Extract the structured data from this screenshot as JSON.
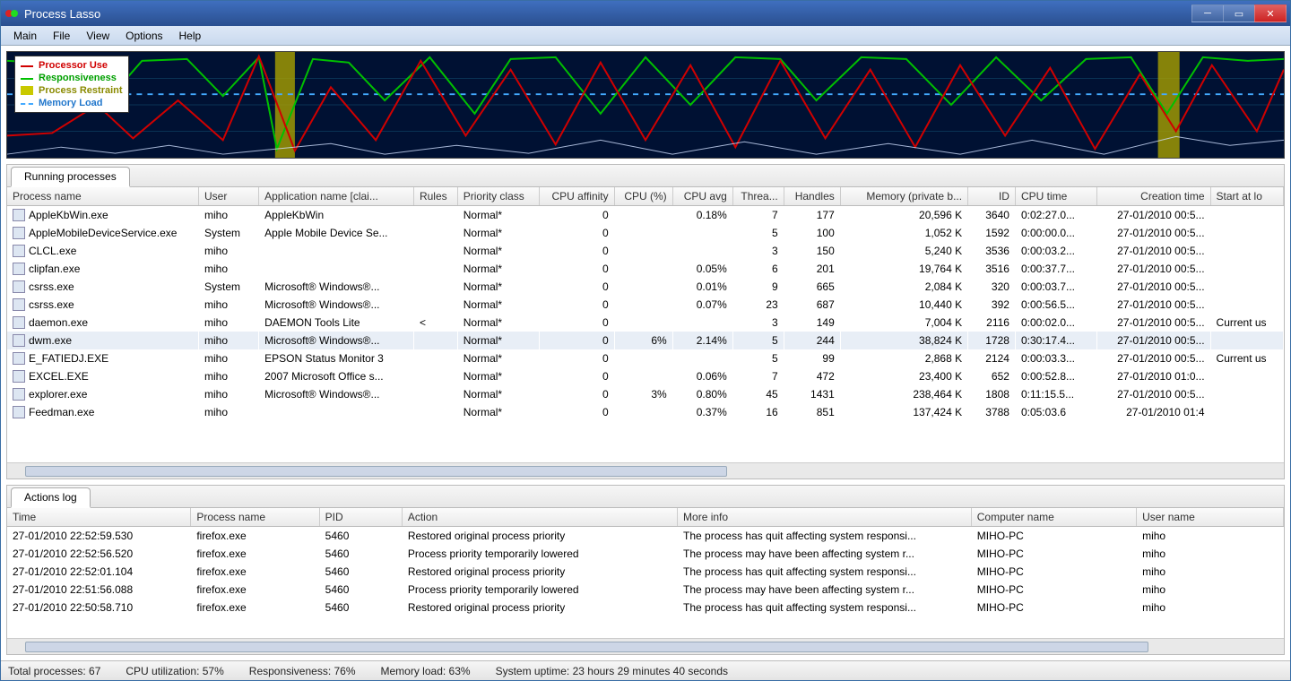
{
  "window": {
    "title": "Process Lasso"
  },
  "menu": [
    "Main",
    "File",
    "View",
    "Options",
    "Help"
  ],
  "legend": {
    "processor_use": "Processor Use",
    "responsiveness": "Responsiveness",
    "process_restraint": "Process Restraint",
    "memory_load": "Memory Load"
  },
  "colors": {
    "red": "#d00000",
    "green": "#00c000",
    "yellow": "#c9c900",
    "blue": "#44aaff",
    "graph_bg": "#001133"
  },
  "top_tab": "Running processes",
  "columns_top": [
    "Process name",
    "User",
    "Application name [clai...",
    "Rules",
    "Priority class",
    "CPU affinity",
    "CPU (%)",
    "CPU avg",
    "Threa...",
    "Handles",
    "Memory (private b...",
    "ID",
    "CPU time",
    "Creation time",
    "Start at lo"
  ],
  "processes": [
    {
      "name": "AppleKbWin.exe",
      "user": "miho",
      "app": "AppleKbWin",
      "rules": "",
      "prio": "Normal*",
      "aff": "0",
      "cpu": "",
      "avg": "0.18%",
      "thr": "7",
      "hnd": "177",
      "mem": "20,596 K",
      "id": "3640",
      "cputime": "0:02:27.0...",
      "ctime": "27-01/2010 00:5...",
      "start": ""
    },
    {
      "name": "AppleMobileDeviceService.exe",
      "user": "System",
      "app": "Apple Mobile Device Se...",
      "rules": "",
      "prio": "Normal*",
      "aff": "0",
      "cpu": "",
      "avg": "",
      "thr": "5",
      "hnd": "100",
      "mem": "1,052 K",
      "id": "1592",
      "cputime": "0:00:00.0...",
      "ctime": "27-01/2010 00:5...",
      "start": ""
    },
    {
      "name": "CLCL.exe",
      "user": "miho",
      "app": "",
      "rules": "",
      "prio": "Normal*",
      "aff": "0",
      "cpu": "",
      "avg": "",
      "thr": "3",
      "hnd": "150",
      "mem": "5,240 K",
      "id": "3536",
      "cputime": "0:00:03.2...",
      "ctime": "27-01/2010 00:5...",
      "start": ""
    },
    {
      "name": "clipfan.exe",
      "user": "miho",
      "app": "",
      "rules": "",
      "prio": "Normal*",
      "aff": "0",
      "cpu": "",
      "avg": "0.05%",
      "thr": "6",
      "hnd": "201",
      "mem": "19,764 K",
      "id": "3516",
      "cputime": "0:00:37.7...",
      "ctime": "27-01/2010 00:5...",
      "start": ""
    },
    {
      "name": "csrss.exe",
      "user": "System",
      "app": "Microsoft® Windows®...",
      "rules": "",
      "prio": "Normal*",
      "aff": "0",
      "cpu": "",
      "avg": "0.01%",
      "thr": "9",
      "hnd": "665",
      "mem": "2,084 K",
      "id": "320",
      "cputime": "0:00:03.7...",
      "ctime": "27-01/2010 00:5...",
      "start": ""
    },
    {
      "name": "csrss.exe",
      "user": "miho",
      "app": "Microsoft® Windows®...",
      "rules": "",
      "prio": "Normal*",
      "aff": "0",
      "cpu": "",
      "avg": "0.07%",
      "thr": "23",
      "hnd": "687",
      "mem": "10,440 K",
      "id": "392",
      "cputime": "0:00:56.5...",
      "ctime": "27-01/2010 00:5...",
      "start": ""
    },
    {
      "name": "daemon.exe",
      "user": "miho",
      "app": "DAEMON Tools Lite",
      "rules": "<",
      "prio": "Normal*",
      "aff": "0",
      "cpu": "",
      "avg": "",
      "thr": "3",
      "hnd": "149",
      "mem": "7,004 K",
      "id": "2116",
      "cputime": "0:00:02.0...",
      "ctime": "27-01/2010 00:5...",
      "start": "Current us"
    },
    {
      "name": "dwm.exe",
      "user": "miho",
      "app": "Microsoft® Windows®...",
      "rules": "",
      "prio": "Normal*",
      "aff": "0",
      "cpu": "6%",
      "avg": "2.14%",
      "thr": "5",
      "hnd": "244",
      "mem": "38,824 K",
      "id": "1728",
      "cputime": "0:30:17.4...",
      "ctime": "27-01/2010 00:5...",
      "start": "",
      "_selected": true
    },
    {
      "name": "E_FATIEDJ.EXE",
      "user": "miho",
      "app": "EPSON Status Monitor 3",
      "rules": "",
      "prio": "Normal*",
      "aff": "0",
      "cpu": "",
      "avg": "",
      "thr": "5",
      "hnd": "99",
      "mem": "2,868 K",
      "id": "2124",
      "cputime": "0:00:03.3...",
      "ctime": "27-01/2010 00:5...",
      "start": "Current us"
    },
    {
      "name": "EXCEL.EXE",
      "user": "miho",
      "app": "2007 Microsoft Office s...",
      "rules": "",
      "prio": "Normal*",
      "aff": "0",
      "cpu": "",
      "avg": "0.06%",
      "thr": "7",
      "hnd": "472",
      "mem": "23,400 K",
      "id": "652",
      "cputime": "0:00:52.8...",
      "ctime": "27-01/2010 01:0...",
      "start": ""
    },
    {
      "name": "explorer.exe",
      "user": "miho",
      "app": "Microsoft® Windows®...",
      "rules": "",
      "prio": "Normal*",
      "aff": "0",
      "cpu": "3%",
      "avg": "0.80%",
      "thr": "45",
      "hnd": "1431",
      "mem": "238,464 K",
      "id": "1808",
      "cputime": "0:11:15.5...",
      "ctime": "27-01/2010 00:5...",
      "start": ""
    },
    {
      "name": "Feedman.exe",
      "user": "miho",
      "app": "",
      "rules": "",
      "prio": "Normal*",
      "aff": "0",
      "cpu": "",
      "avg": "0.37%",
      "thr": "16",
      "hnd": "851",
      "mem": "137,424 K",
      "id": "3788",
      "cputime": "0:05:03.6",
      "ctime": "27-01/2010 01:4",
      "start": ""
    }
  ],
  "bot_tab": "Actions log",
  "columns_bot": [
    "Time",
    "Process name",
    "PID",
    "Action",
    "More info",
    "Computer name",
    "User name"
  ],
  "actions": [
    {
      "time": "27-01/2010 22:52:59.530",
      "proc": "firefox.exe",
      "pid": "5460",
      "action": "Restored original process priority",
      "info": "The process has quit affecting system responsi...",
      "comp": "MIHO-PC",
      "user": "miho"
    },
    {
      "time": "27-01/2010 22:52:56.520",
      "proc": "firefox.exe",
      "pid": "5460",
      "action": "Process priority temporarily lowered",
      "info": "The process may have been affecting system r...",
      "comp": "MIHO-PC",
      "user": "miho"
    },
    {
      "time": "27-01/2010 22:52:01.104",
      "proc": "firefox.exe",
      "pid": "5460",
      "action": "Restored original process priority",
      "info": "The process has quit affecting system responsi...",
      "comp": "MIHO-PC",
      "user": "miho"
    },
    {
      "time": "27-01/2010 22:51:56.088",
      "proc": "firefox.exe",
      "pid": "5460",
      "action": "Process priority temporarily lowered",
      "info": "The process may have been affecting system r...",
      "comp": "MIHO-PC",
      "user": "miho"
    },
    {
      "time": "27-01/2010 22:50:58.710",
      "proc": "firefox.exe",
      "pid": "5460",
      "action": "Restored original process priority",
      "info": "The process has quit affecting system responsi...",
      "comp": "MIHO-PC",
      "user": "miho"
    }
  ],
  "status": {
    "total": "Total processes: 67",
    "cpu": "CPU utilization: 57%",
    "resp": "Responsiveness: 76%",
    "mem": "Memory load: 63%",
    "uptime": "System uptime: 23 hours 29 minutes 40 seconds"
  }
}
